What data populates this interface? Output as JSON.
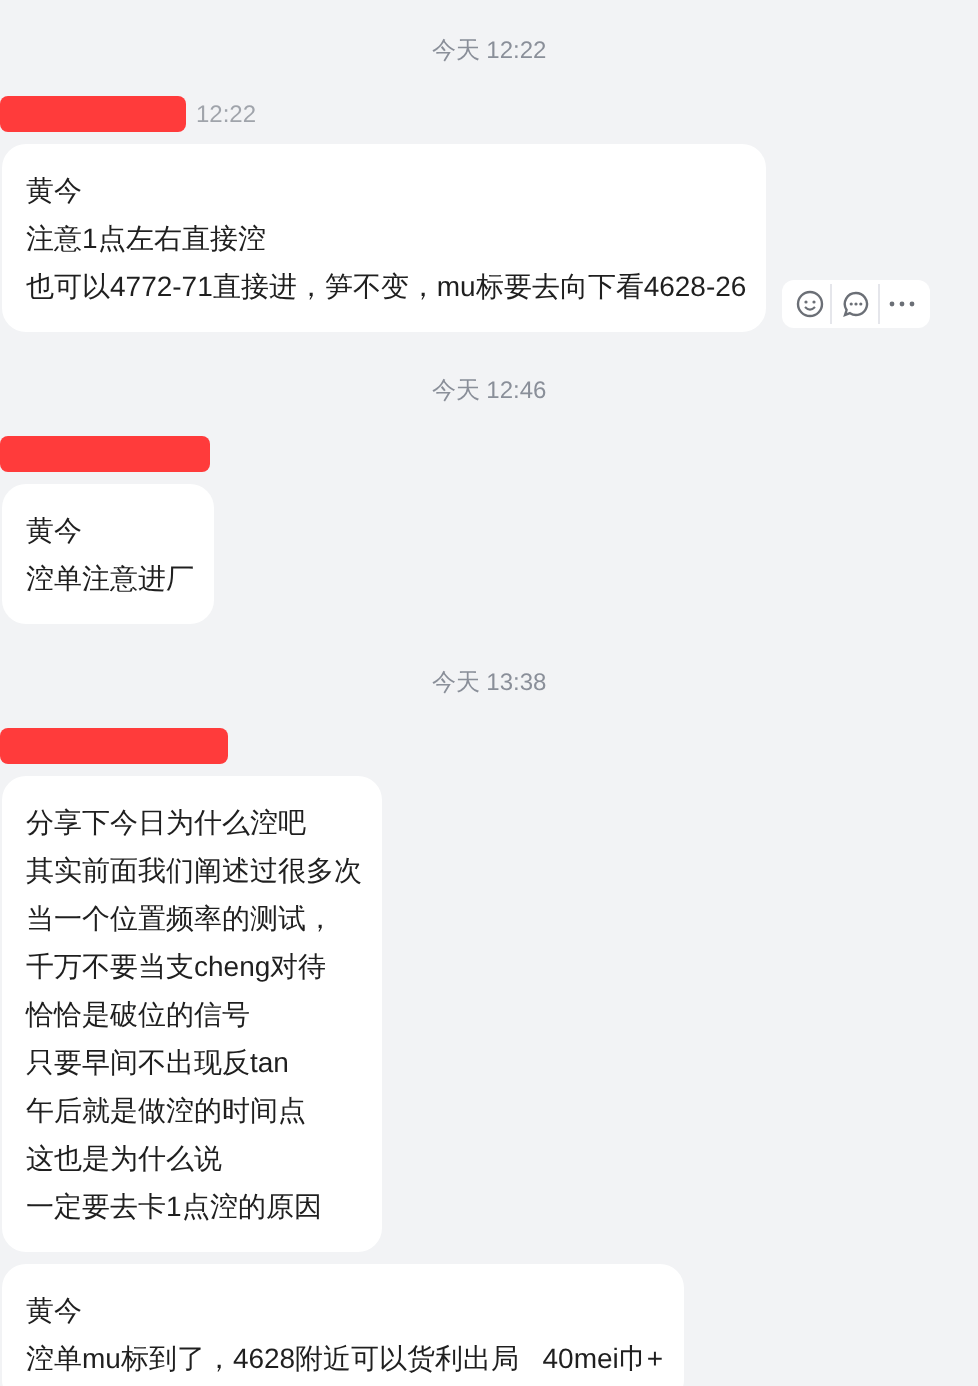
{
  "items": [
    {
      "kind": "time",
      "text": "今天 12:22"
    },
    {
      "kind": "message",
      "sender_redacted": true,
      "time": "12:22",
      "hovered": true,
      "lines": [
        "黄今",
        "注意1点左右直接涳",
        "也可以4772-71直接进，笋不变，mu标要去向下看4628-26"
      ]
    },
    {
      "kind": "time",
      "text": "今天 12:46"
    },
    {
      "kind": "message",
      "sender_redacted": true,
      "hovered": false,
      "lines": [
        "黄今",
        "涳单注意进厂"
      ]
    },
    {
      "kind": "time",
      "text": "今天 13:38"
    },
    {
      "kind": "message",
      "sender_redacted": true,
      "hovered": false,
      "lines": [
        "分享下今日为什么涳吧",
        "其实前面我们阐述过很多次",
        "当一个位置频率的测试，",
        "千万不要当支cheng对待",
        "恰恰是破位的信号",
        "只要早间不出现反tan",
        "午后就是做涳的时间点",
        "这也是为什么说",
        "一定要去卡1点涳的原因"
      ]
    },
    {
      "kind": "message",
      "sender_redacted": false,
      "hovered": false,
      "lines": [
        "黄今",
        "涳单mu标到了，4628附近可以货利出局   40mei巾+"
      ]
    }
  ]
}
